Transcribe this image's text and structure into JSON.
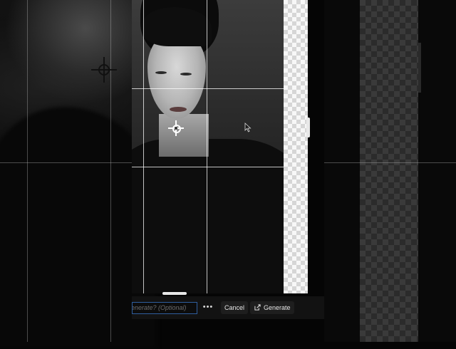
{
  "toolbar": {
    "prompt_placeholder": "enerate? (Optional)",
    "more_label": "•••",
    "cancel_label": "Cancel",
    "generate_label": "Generate"
  },
  "icons": {
    "focus_point": "crosshair-icon",
    "cursor": "pointer-cursor-icon",
    "generate": "generate-icon",
    "more": "more-options-icon"
  },
  "colors": {
    "input_border": "#2f5e9e",
    "button_bg": "#1e1e1e",
    "background": "#050505"
  }
}
